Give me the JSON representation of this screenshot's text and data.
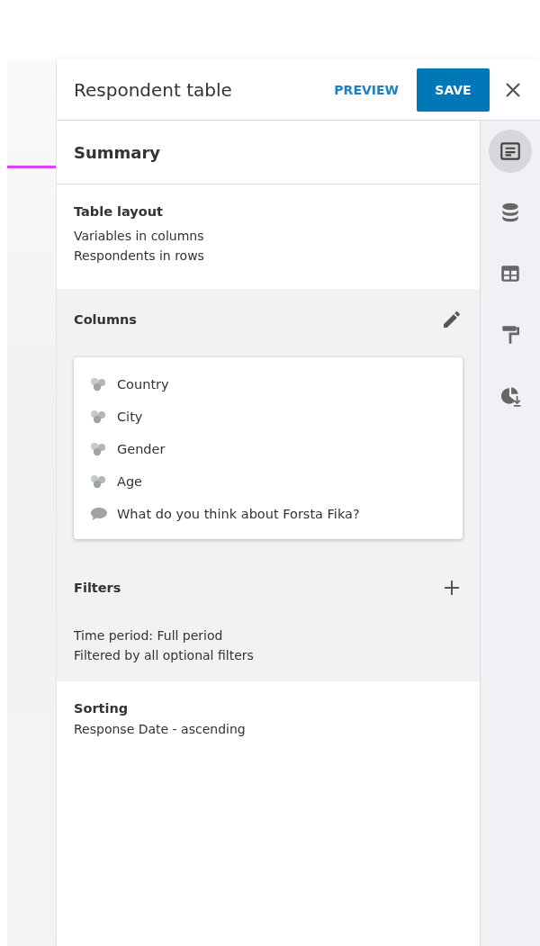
{
  "header": {
    "title": "Respondent table",
    "preview": "PREVIEW",
    "save": "SAVE"
  },
  "summary": {
    "title": "Summary"
  },
  "table_layout": {
    "title": "Table layout",
    "lines": [
      "Variables in columns",
      "Respondents in rows"
    ]
  },
  "columns": {
    "title": "Columns",
    "items": [
      {
        "label": "Country",
        "kind": "categorical"
      },
      {
        "label": "City",
        "kind": "categorical"
      },
      {
        "label": "Gender",
        "kind": "categorical"
      },
      {
        "label": "Age",
        "kind": "categorical"
      },
      {
        "label": "What do you think about Forsta Fika?",
        "kind": "open_text"
      }
    ]
  },
  "filters": {
    "title": "Filters",
    "lines": [
      "Time period: Full period",
      "Filtered by all optional filters"
    ]
  },
  "sorting": {
    "title": "Sorting",
    "lines": [
      "Response Date - ascending"
    ]
  },
  "rail": [
    {
      "kind": "summary",
      "selected": true
    },
    {
      "kind": "data",
      "selected": false
    },
    {
      "kind": "table",
      "selected": false
    },
    {
      "kind": "format",
      "selected": false
    },
    {
      "kind": "export",
      "selected": false
    }
  ]
}
